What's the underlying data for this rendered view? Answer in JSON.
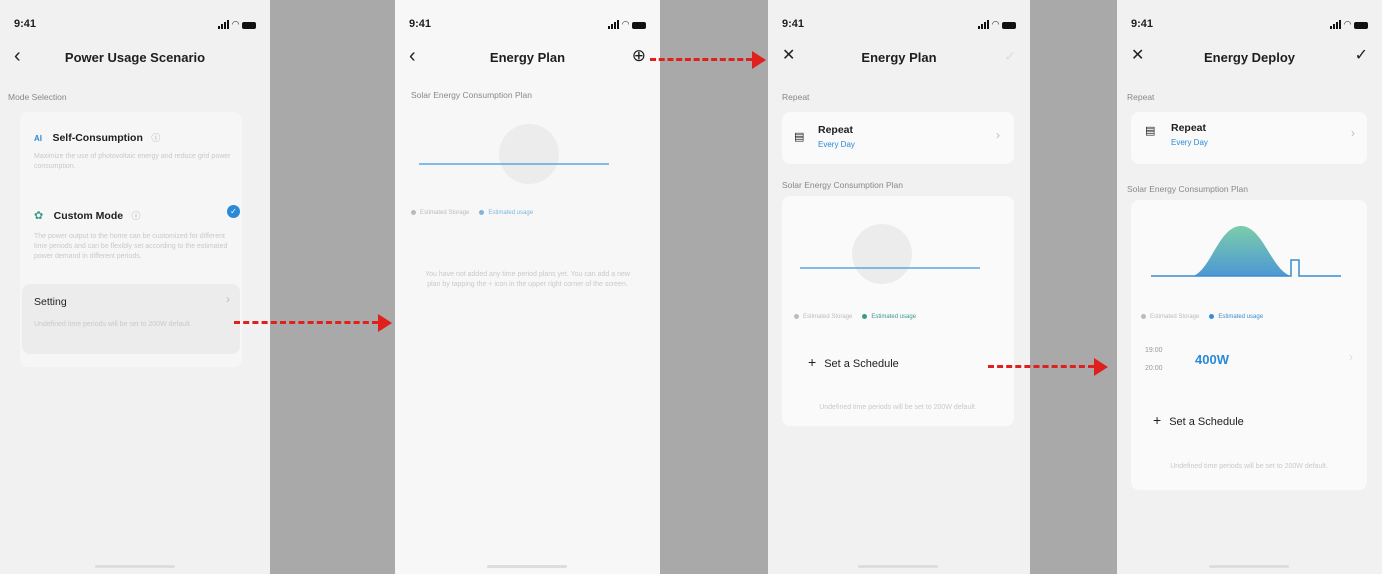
{
  "status_time": "9:41",
  "screen1": {
    "title": "Power Usage Scenario",
    "section": "Mode Selection",
    "self_consumption": {
      "badge": "AI",
      "label": "Self-Consumption",
      "desc": "Maximize the use of photovoltaic energy and reduce grid power consumption."
    },
    "custom_mode": {
      "label": "Custom Mode",
      "desc": "The power output to the home can be customized for different time periods and can be flexibly set according to the estimated power demand in different periods."
    },
    "setting": {
      "label": "Setting",
      "desc": "Undefined time periods will be set to 200W default."
    }
  },
  "screen2": {
    "title": "Energy Plan",
    "section": "Solar Energy Consumption Plan",
    "legend": [
      "Estimated Storage",
      "Estimated usage"
    ],
    "empty_text": "You have not added any time period plans yet. You can add a new plan by tapping the + icon in the upper right corner of the screen."
  },
  "screen3": {
    "title": "Energy Plan",
    "section_repeat": "Repeat",
    "repeat_label": "Repeat",
    "repeat_value": "Every Day",
    "section_plan": "Solar Energy Consumption Plan",
    "legend": [
      "Estimated Storage",
      "Estimated usage"
    ],
    "add_schedule": "Set a Schedule",
    "footnote": "Undefined time periods will be set to 200W default."
  },
  "screen4": {
    "title": "Energy Deploy",
    "section_repeat": "Repeat",
    "repeat_label": "Repeat",
    "repeat_value": "Every Day",
    "section_plan": "Solar Energy Consumption Plan",
    "legend": [
      "Estimated Storage",
      "Estimated usage"
    ],
    "schedule_start": "19:00",
    "schedule_end": "20:00",
    "schedule_power": "400W",
    "add_schedule": "Set a Schedule",
    "footnote": "Undefined time periods will be set to 200W default."
  },
  "colors": {
    "accent_blue": "#2a8ad8",
    "teal": "#3a9a8a",
    "arrow_red": "#e0201d",
    "divider_gray": "#a9a9a9"
  }
}
